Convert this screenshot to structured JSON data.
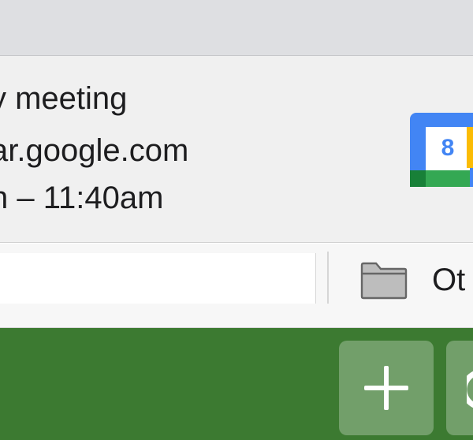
{
  "notification": {
    "title": "y meeting",
    "source": "ar.google.com",
    "time": "n – 11:40am",
    "app_icon": "google-calendar-icon",
    "calendar_day": "8"
  },
  "bookmarks_bar": {
    "folder_icon": "folder-icon",
    "folder_label": "Ot"
  },
  "taskbar": {
    "add_icon": "plus-icon",
    "next_icon": "partial-tile-icon"
  },
  "colors": {
    "titlebar": "#dedfe2",
    "notification_bg": "#f0f0f0",
    "taskbar_green": "#3c7a31",
    "calendar_blue": "#4285f4",
    "calendar_red": "#ea4335",
    "calendar_yellow": "#fbbc04",
    "calendar_green": "#34a853"
  }
}
